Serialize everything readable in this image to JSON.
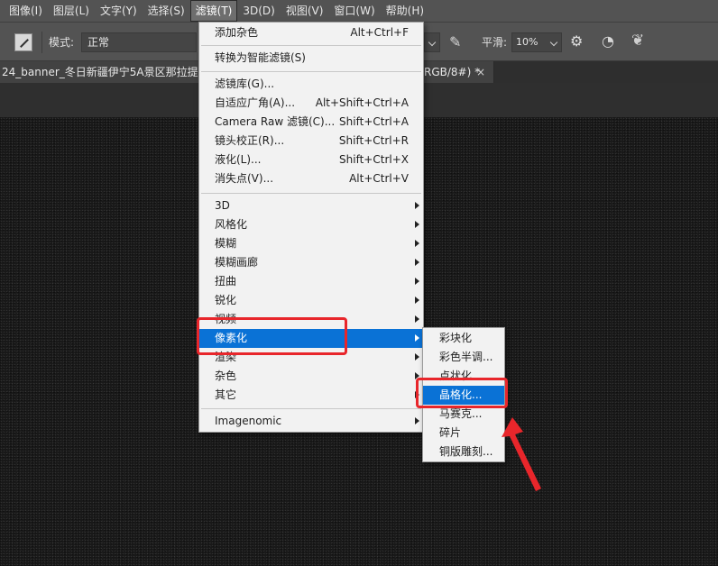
{
  "menubar": {
    "items": [
      {
        "label": "图像(I)"
      },
      {
        "label": "图层(L)"
      },
      {
        "label": "文字(Y)"
      },
      {
        "label": "选择(S)"
      },
      {
        "label": "滤镜(T)"
      },
      {
        "label": "3D(D)"
      },
      {
        "label": "视图(V)"
      },
      {
        "label": "窗口(W)"
      },
      {
        "label": "帮助(H)"
      }
    ]
  },
  "options_bar": {
    "mode_label": "模式:",
    "mode_value": "正常",
    "smoothing_label": "平滑:",
    "smoothing_value": "10%"
  },
  "document": {
    "tab_title": "24_banner_冬日新疆伊宁5A景区那拉提",
    "tab_suffix": "RGB/8#) *",
    "close_glyph": "×"
  },
  "filter_menu": {
    "items": [
      {
        "label": "添加杂色",
        "shortcut": "Alt+Ctrl+F"
      },
      {
        "label": "转换为智能滤镜(S)",
        "shortcut": ""
      },
      {
        "label": "滤镜库(G)...",
        "shortcut": ""
      },
      {
        "label": "自适应广角(A)...",
        "shortcut": "Alt+Shift+Ctrl+A"
      },
      {
        "label": "Camera Raw 滤镜(C)...",
        "shortcut": "Shift+Ctrl+A"
      },
      {
        "label": "镜头校正(R)...",
        "shortcut": "Shift+Ctrl+R"
      },
      {
        "label": "液化(L)...",
        "shortcut": "Shift+Ctrl+X"
      },
      {
        "label": "消失点(V)...",
        "shortcut": "Alt+Ctrl+V"
      },
      {
        "label": "3D"
      },
      {
        "label": "风格化"
      },
      {
        "label": "模糊"
      },
      {
        "label": "模糊画廊"
      },
      {
        "label": "扭曲"
      },
      {
        "label": "锐化"
      },
      {
        "label": "视频"
      },
      {
        "label": "像素化"
      },
      {
        "label": "渲染"
      },
      {
        "label": "杂色"
      },
      {
        "label": "其它"
      },
      {
        "label": "Imagenomic"
      }
    ]
  },
  "pixelate_submenu": {
    "items": [
      {
        "label": "彩块化"
      },
      {
        "label": "彩色半调..."
      },
      {
        "label": "点状化..."
      },
      {
        "label": "晶格化..."
      },
      {
        "label": "马赛克..."
      },
      {
        "label": "碎片"
      },
      {
        "label": "铜版雕刻..."
      }
    ]
  },
  "colors": {
    "menu_highlight": "#0a72d6",
    "annotation": "#e8262b"
  }
}
